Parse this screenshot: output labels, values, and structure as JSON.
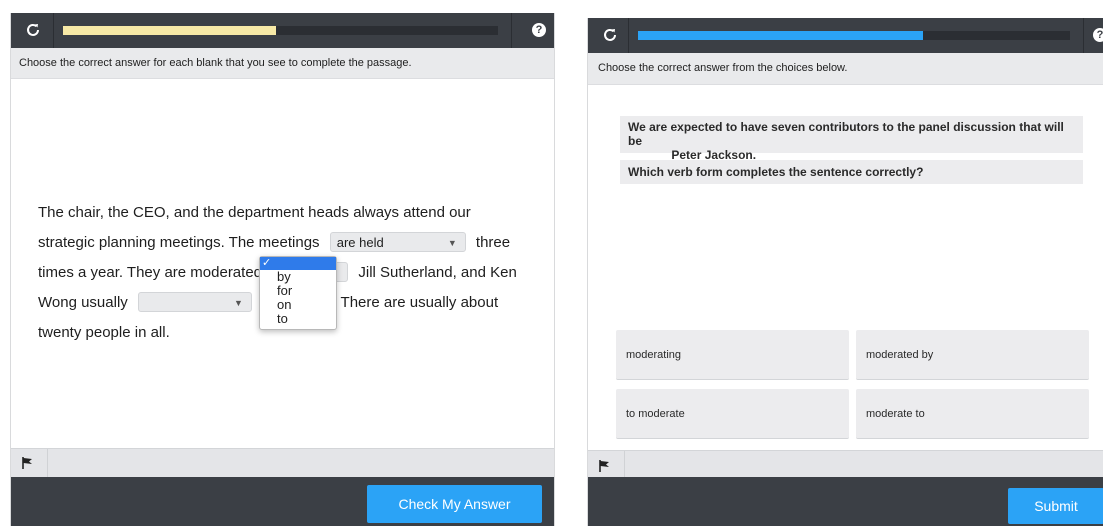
{
  "left_panel": {
    "progress_percent": 49,
    "help_label": "?",
    "instruction": "Choose the correct answer for each blank that you see to complete the passage.",
    "passage": {
      "line1": "The chair, the CEO, and the department heads always attend our",
      "line2_before": "strategic planning meetings. The meetings",
      "select1_value": "are held",
      "line2_after": "three",
      "line3_before": "times a year. They are moderated",
      "line3_after": "Jill Sutherland, and Ken",
      "line4_before": "Wong usually",
      "select3_value": "",
      "line4_mid": "t",
      "line4_after": ". There are usually about",
      "line5": "twenty people in all."
    },
    "dropdown": {
      "selected_mark": "✓",
      "options": [
        "by",
        "for",
        "on",
        "to"
      ]
    },
    "check_button": "Check My Answer"
  },
  "right_panel": {
    "progress_percent": 66,
    "instruction": "Choose the correct answer from the choices below.",
    "question_line1": "We are expected to have seven contributors to the panel discussion that will be",
    "question_line2": "______ Peter Jackson.",
    "prompt": "Which verb form completes the sentence correctly?",
    "choices": [
      "moderating",
      "moderated by",
      "to moderate",
      "moderate to"
    ],
    "submit_button": "Submit"
  },
  "colors": {
    "toolbar": "#3b3f45",
    "progress_left": "#f7e9a6",
    "progress_right": "#2ba3f6",
    "button": "#2ba3f6",
    "selection": "#2f7bea"
  }
}
